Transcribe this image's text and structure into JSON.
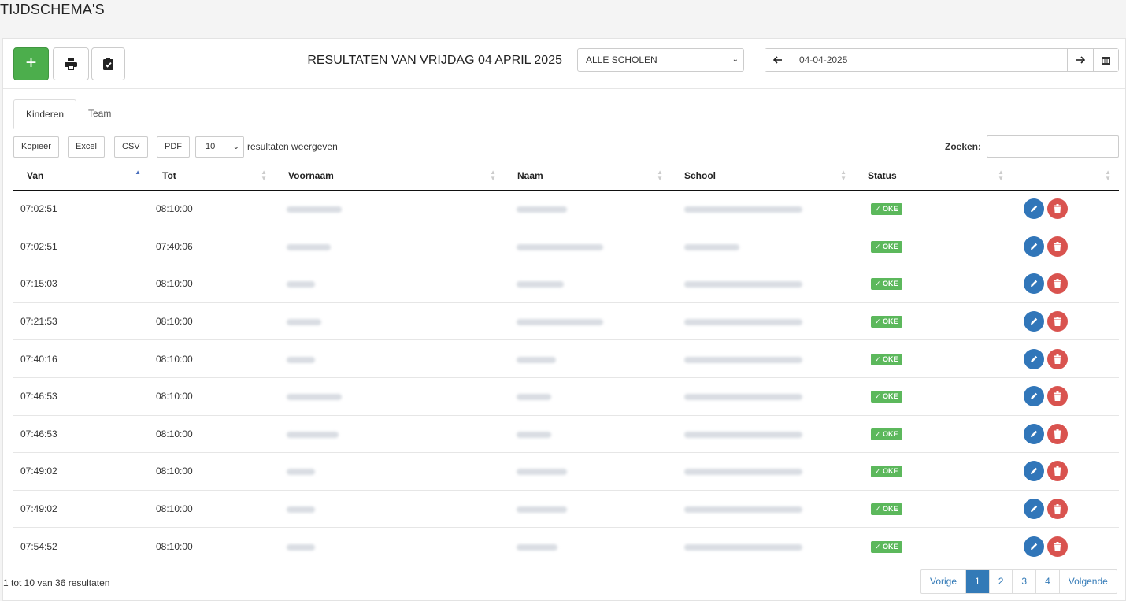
{
  "page": {
    "title": "TIJDSCHEMA'S"
  },
  "toolbar": {
    "add_label": "+",
    "results_title": "RESULTATEN VAN VRIJDAG 04 APRIL 2025",
    "school_select": "ALLE SCHOLEN",
    "date_value": "04-04-2025",
    "icons": [
      "plus-icon",
      "printer-icon",
      "clipboard-check-icon",
      "arrow-left-icon",
      "arrow-right-icon",
      "calendar-icon"
    ]
  },
  "tabs": [
    {
      "label": "Kinderen",
      "active": true
    },
    {
      "label": "Team",
      "active": false
    }
  ],
  "datatable": {
    "buttons": [
      "Kopieer",
      "Excel",
      "CSV",
      "PDF"
    ],
    "length_value": "10",
    "length_text": "resultaten weergeven",
    "search_label": "Zoeken:",
    "columns": [
      "Van",
      "Tot",
      "Voornaam",
      "Naam",
      "School",
      "Status"
    ],
    "rows": [
      {
        "van": "07:02:51",
        "tot": "08:10:00",
        "status": "OKE"
      },
      {
        "van": "07:02:51",
        "tot": "07:40:06",
        "status": "OKE"
      },
      {
        "van": "07:15:03",
        "tot": "08:10:00",
        "status": "OKE"
      },
      {
        "van": "07:21:53",
        "tot": "08:10:00",
        "status": "OKE"
      },
      {
        "van": "07:40:16",
        "tot": "08:10:00",
        "status": "OKE"
      },
      {
        "van": "07:46:53",
        "tot": "08:10:00",
        "status": "OKE"
      },
      {
        "van": "07:46:53",
        "tot": "08:10:00",
        "status": "OKE"
      },
      {
        "van": "07:49:02",
        "tot": "08:10:00",
        "status": "OKE"
      },
      {
        "van": "07:49:02",
        "tot": "08:10:00",
        "status": "OKE"
      },
      {
        "van": "07:54:52",
        "tot": "08:10:00",
        "status": "OKE"
      }
    ],
    "info": "1 tot 10 van 36 resultaten",
    "pagination": {
      "prev": "Vorige",
      "pages": [
        "1",
        "2",
        "3",
        "4"
      ],
      "active": "1",
      "next": "Volgende"
    }
  },
  "colors": {
    "add": "#4cae4c",
    "edit": "#3176b9",
    "delete": "#d9534f",
    "ok_badge": "#5cb85c",
    "accent": "#337ab7"
  }
}
